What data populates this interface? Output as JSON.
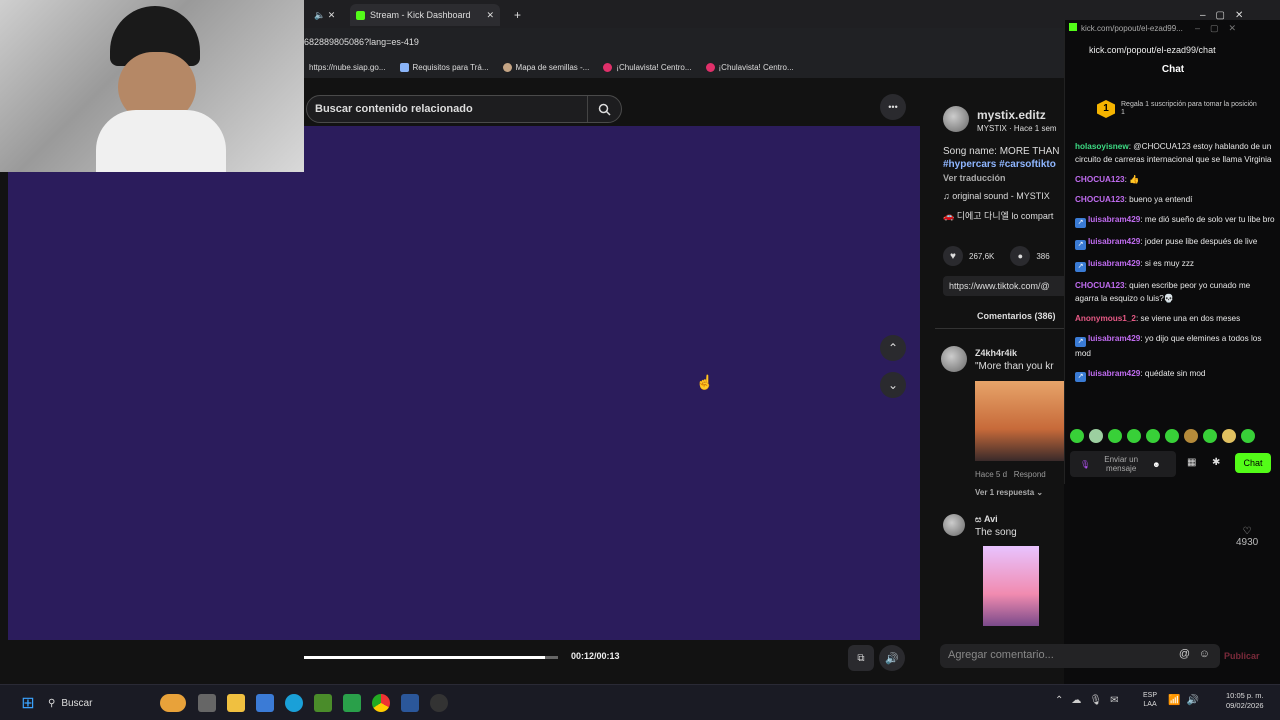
{
  "browser": {
    "tabs": [
      {
        "label": "Stream - Kick Dashboard"
      }
    ],
    "new_tab": "+",
    "url": "682889805086?lang=es-419",
    "bookmarks": [
      {
        "label": "https://nube.siap.go...",
        "color": "#9aa0a6"
      },
      {
        "label": "Requisitos para Trá...",
        "color": "#8ab4f8"
      },
      {
        "label": "Mapa de semillas -...",
        "color": "#c4a484"
      },
      {
        "label": "¡Chulavista! Centro...",
        "color": "#e0306a"
      },
      {
        "label": "¡Chulavista! Centro...",
        "color": "#e0306a"
      }
    ]
  },
  "tiktok": {
    "search_placeholder": "Buscar contenido relacionado",
    "more": "•••",
    "time": "00:12/00:13",
    "progress": 0.95,
    "author": {
      "name": "mystix.editz",
      "sub": "MYSTIX · Hace 1 sem"
    },
    "caption": "Song name: MORE THAN",
    "hashtags": "#hypercars #carsoftikto",
    "translate": "Ver traducción",
    "sound": "original sound - MYSTIX",
    "sound2": "🚗 디에고 다니엘 lo compart",
    "likes": "267,6K",
    "comments_count": "386",
    "link": "https://www.tiktok.com/@",
    "comments_tab": "Comentarios (386)",
    "comments": [
      {
        "user": "Z4kh4r4ik",
        "text": "\"More than you kr",
        "meta": "Hace 5 d",
        "reply": "Respond",
        "view_replies": "Ver 1 respuesta"
      },
      {
        "user": "ස Avi",
        "text": "The song",
        "likes": "4930"
      }
    ],
    "add_comment_placeholder": "Agregar comentario...",
    "publish": "Publicar",
    "colors": {
      "video_bg": "#2b1c5c"
    }
  },
  "kick": {
    "window_url": "kick.com/popout/el-ezad99...",
    "address": "kick.com/popout/el-ezad99/chat",
    "title": "Chat",
    "pinned": "Regala 1 suscripción para tomar la posición 1",
    "pinned_rank": "1",
    "messages": [
      {
        "user": "holasoyisnew",
        "text": ": @CHOCUA123 estoy hablando de un circuito de carreras internacional que se llama Virginia",
        "color": "#3ddc84",
        "badge": false
      },
      {
        "user": "CHOCUA123",
        "text": ": 👍",
        "color": "#c06cf0",
        "badge": false
      },
      {
        "user": "CHOCUA123",
        "text": ": bueno ya entendí",
        "color": "#c06cf0",
        "badge": false
      },
      {
        "user": "luisabram429",
        "text": ": me dió sueño de solo ver tu libe bro",
        "color": "#c06cf0",
        "badge": true
      },
      {
        "user": "luisabram429",
        "text": ": joder puse libe después de live",
        "color": "#c06cf0",
        "badge": true
      },
      {
        "user": "luisabram429",
        "text": ": si es muy zzz",
        "color": "#c06cf0",
        "badge": true
      },
      {
        "user": "CHOCUA123",
        "text": ": quien escribe peor yo cunado me agarra la esquizo o luis?💀",
        "color": "#c06cf0",
        "badge": false
      },
      {
        "user": "Anonymous1_2",
        "text": ": se viene una en dos meses",
        "color": "#e85a86",
        "badge": false
      },
      {
        "user": "luisabram429",
        "text": ": yo dijo que elemines a todos los mod",
        "color": "#c06cf0",
        "badge": true
      },
      {
        "user": "luisabram429",
        "text": ": quédate sin mod",
        "color": "#c06cf0",
        "badge": true
      }
    ],
    "input_placeholder": "Enviar un mensaje",
    "send": "Chat",
    "accent": "#53fc18"
  },
  "taskbar": {
    "search": "Buscar",
    "lang": "ESP",
    "lang2": "LAA",
    "time": "10:05 p. m.",
    "date": "09/02/2026"
  }
}
